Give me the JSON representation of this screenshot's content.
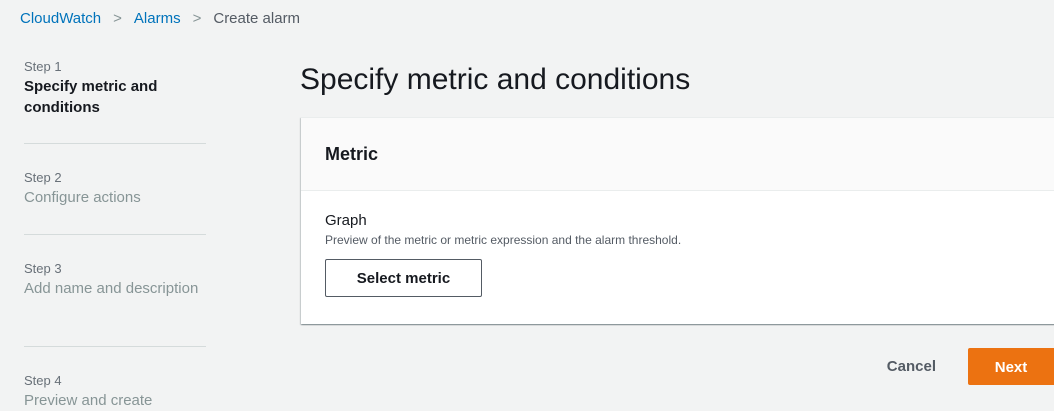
{
  "breadcrumb": {
    "items": [
      "CloudWatch",
      "Alarms",
      "Create alarm"
    ],
    "separator": ">"
  },
  "steps": [
    {
      "number": "Step 1",
      "title": "Specify metric and conditions",
      "active": true
    },
    {
      "number": "Step 2",
      "title": "Configure actions",
      "active": false
    },
    {
      "number": "Step 3",
      "title": "Add name and description",
      "active": false
    },
    {
      "number": "Step 4",
      "title": "Preview and create",
      "active": false
    }
  ],
  "main": {
    "title": "Specify metric and conditions",
    "panel": {
      "title": "Metric",
      "graph_label": "Graph",
      "graph_description": "Preview of the metric or metric expression and the alarm threshold.",
      "select_metric_label": "Select metric"
    }
  },
  "actions": {
    "cancel_label": "Cancel",
    "next_label": "Next"
  },
  "colors": {
    "link": "#0073bb",
    "primary_button": "#ec7211",
    "background": "#f2f3f3"
  }
}
